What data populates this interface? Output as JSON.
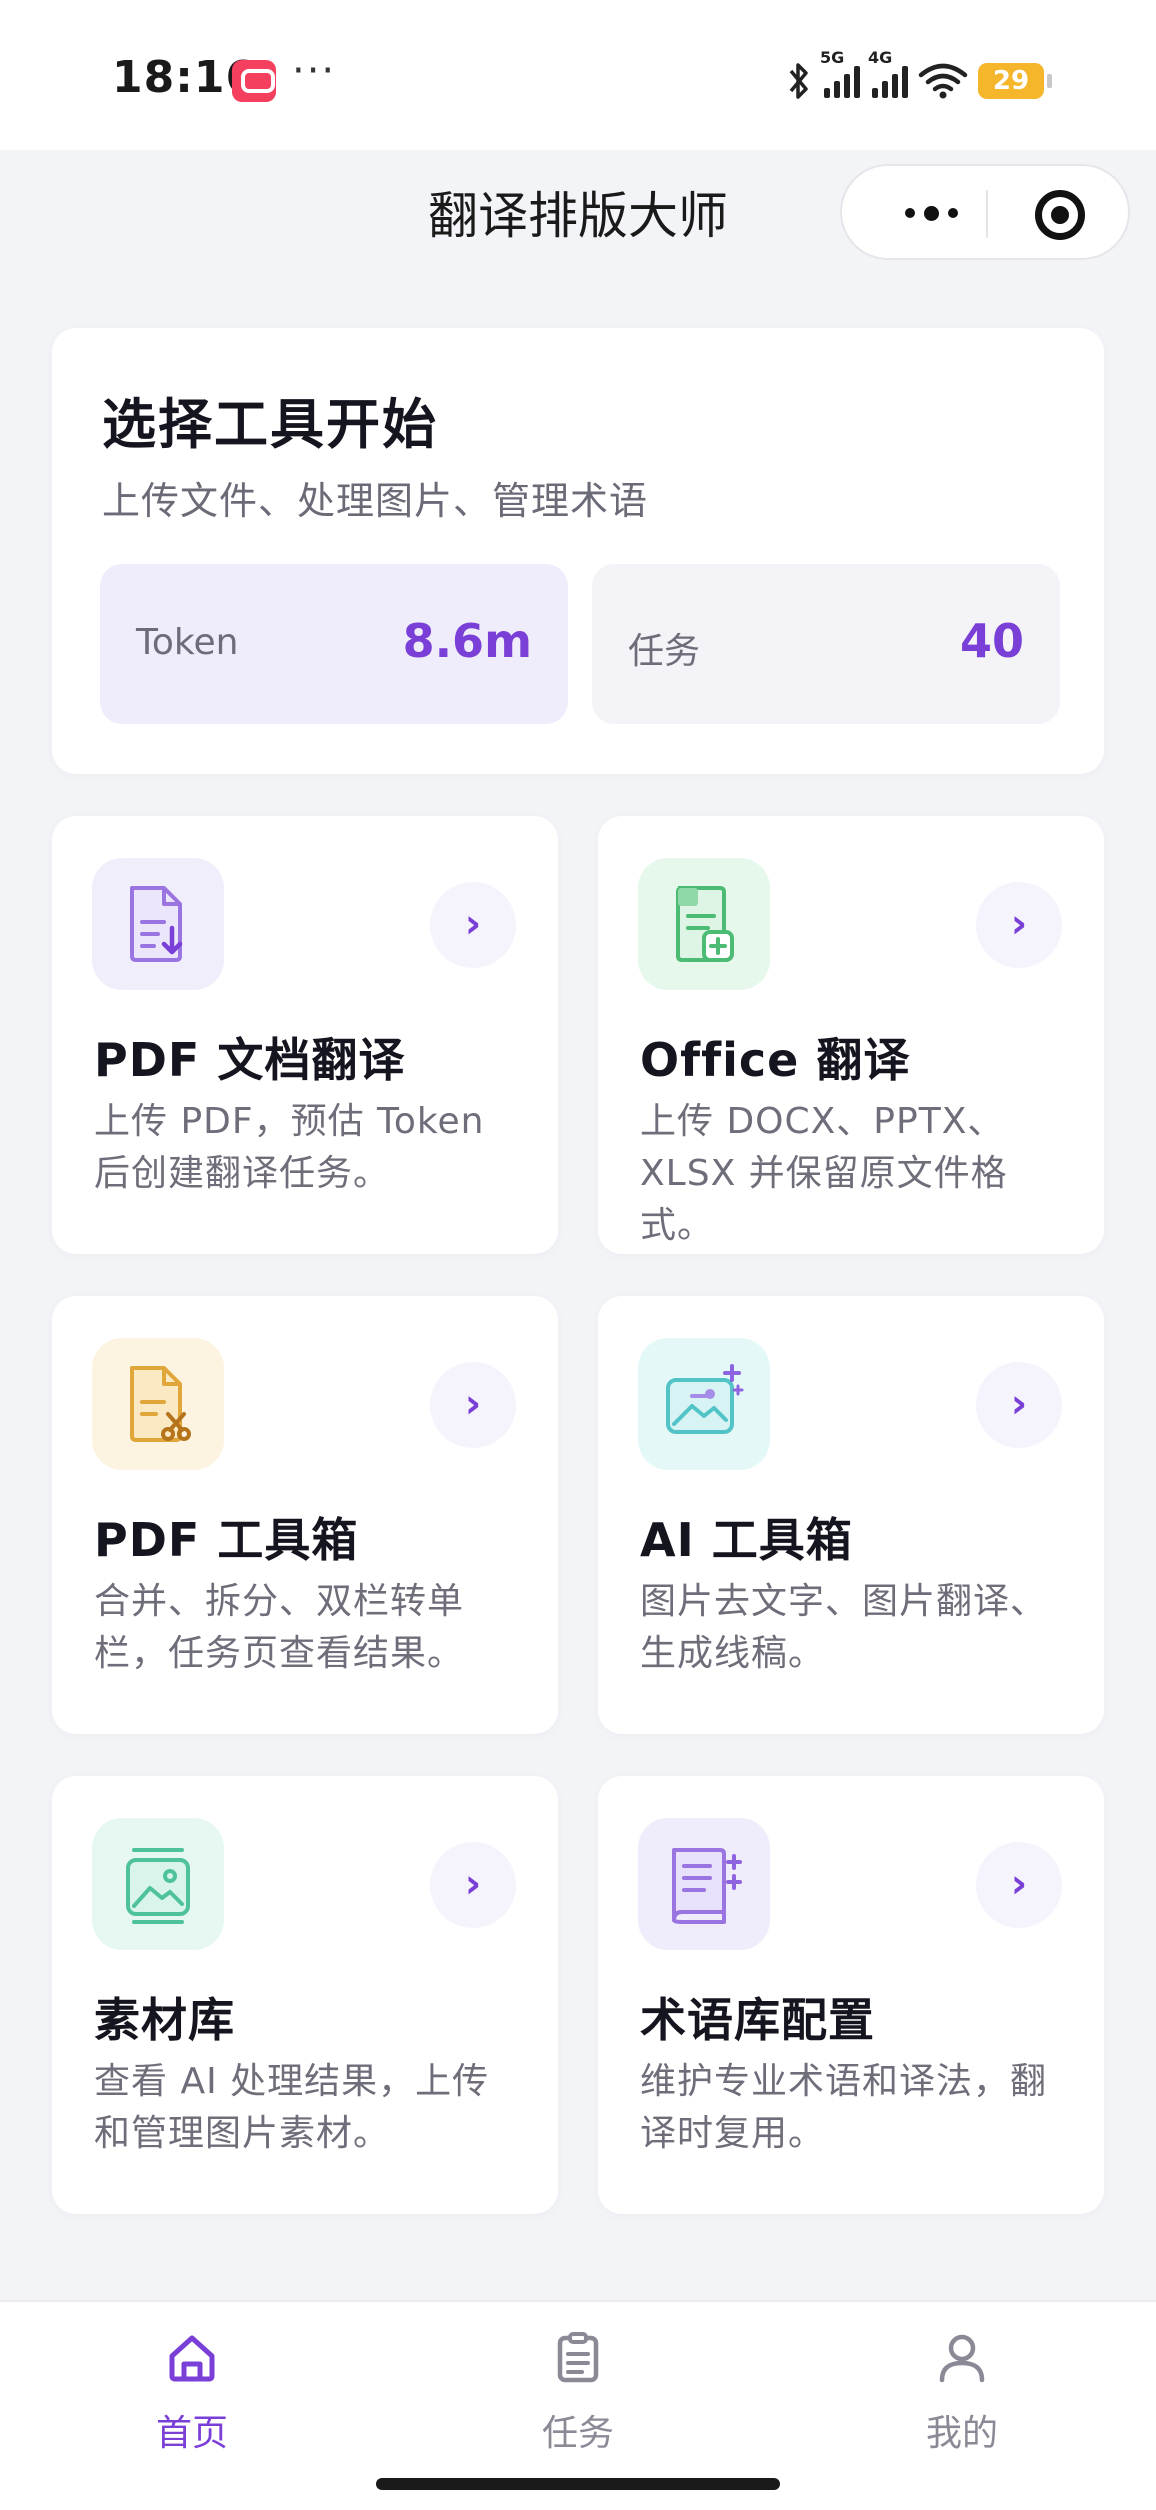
{
  "status_bar": {
    "time": "18:16",
    "dots": "···",
    "signal_1": "5G",
    "signal_2": "4G",
    "battery": "29"
  },
  "nav": {
    "title": "翻译排版大师"
  },
  "summary": {
    "title": "选择工具开始",
    "subtitle": "上传文件、处理图片、管理术语",
    "token_label": "Token",
    "token_value": "8.6m",
    "task_label": "任务",
    "task_value": "40"
  },
  "tools": [
    {
      "title": "PDF 文档翻译",
      "desc": "上传 PDF，预估 Token 后创建翻译任务。",
      "icon": "pdf-document-icon",
      "arrow": "›"
    },
    {
      "title": "Office 翻译",
      "desc": "上传 DOCX、PPTX、XLSX 并保留原文件格式。",
      "icon": "office-document-icon",
      "arrow": "›"
    },
    {
      "title": "PDF 工具箱",
      "desc": "合并、拆分、双栏转单栏，任务页查看结果。",
      "icon": "pdf-toolbox-icon",
      "arrow": "›"
    },
    {
      "title": "AI 工具箱",
      "desc": "图片去文字、图片翻译、生成线稿。",
      "icon": "ai-image-icon",
      "arrow": "›"
    },
    {
      "title": "素材库",
      "desc": "查看 AI 处理结果，上传和管理图片素材。",
      "icon": "material-library-icon",
      "arrow": "›"
    },
    {
      "title": "术语库配置",
      "desc": "维护专业术语和译法，翻译时复用。",
      "icon": "glossary-icon",
      "arrow": "›"
    }
  ],
  "tab_bar": {
    "items": [
      {
        "label": "首页",
        "icon": "home-icon",
        "active": true
      },
      {
        "label": "任务",
        "icon": "clipboard-icon",
        "active": false
      },
      {
        "label": "我的",
        "icon": "user-icon",
        "active": false
      }
    ]
  },
  "colors": {
    "accent": "#7a3fd6",
    "background": "#f3f4f8",
    "card": "#ffffff"
  }
}
